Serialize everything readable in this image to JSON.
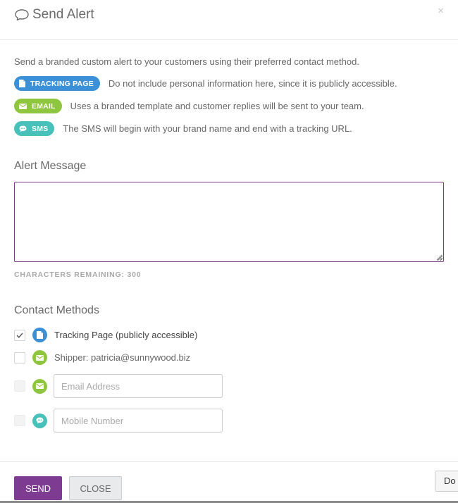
{
  "header": {
    "title": "Send Alert",
    "close_glyph": "×",
    "icons": {
      "title": "speech-bubble-icon",
      "close": "close-icon"
    }
  },
  "intro": "Send a branded custom alert to your customers using their preferred contact method.",
  "legend": [
    {
      "badge": "TRACKING PAGE",
      "icon": "document-icon",
      "color": "#3b90d8",
      "text": "Do not include personal information here, since it is publicly accessible."
    },
    {
      "badge": "EMAIL",
      "icon": "envelope-icon",
      "color": "#8ec63f",
      "text": "Uses a branded template and customer replies will be sent to your team."
    },
    {
      "badge": "SMS",
      "icon": "chat-icon",
      "color": "#47c1b9",
      "text": "The SMS will begin with your brand name and end with a tracking URL."
    }
  ],
  "alert_message": {
    "title": "Alert Message",
    "value": "",
    "chars_remaining": "CHARACTERS REMAINING: 300"
  },
  "contact_methods": {
    "title": "Contact Methods",
    "items": [
      {
        "label": "Tracking Page (publicly accessible)",
        "checked": true,
        "icon": "document-icon"
      },
      {
        "label": "Shipper: patricia@sunnywood.biz",
        "checked": false,
        "icon": "envelope-icon"
      },
      {
        "placeholder": "Email Address",
        "value": "",
        "checked": false,
        "disabled": true,
        "icon": "envelope-icon"
      },
      {
        "placeholder": "Mobile Number",
        "value": "",
        "checked": false,
        "disabled": true,
        "icon": "chat-icon"
      }
    ]
  },
  "footer": {
    "send_label": "SEND",
    "close_label": "CLOSE",
    "peek_label": "Do"
  },
  "colors": {
    "accent": "#7d3c92",
    "tracking": "#3b90d8",
    "email": "#8ec63f",
    "sms": "#47c1b9"
  }
}
